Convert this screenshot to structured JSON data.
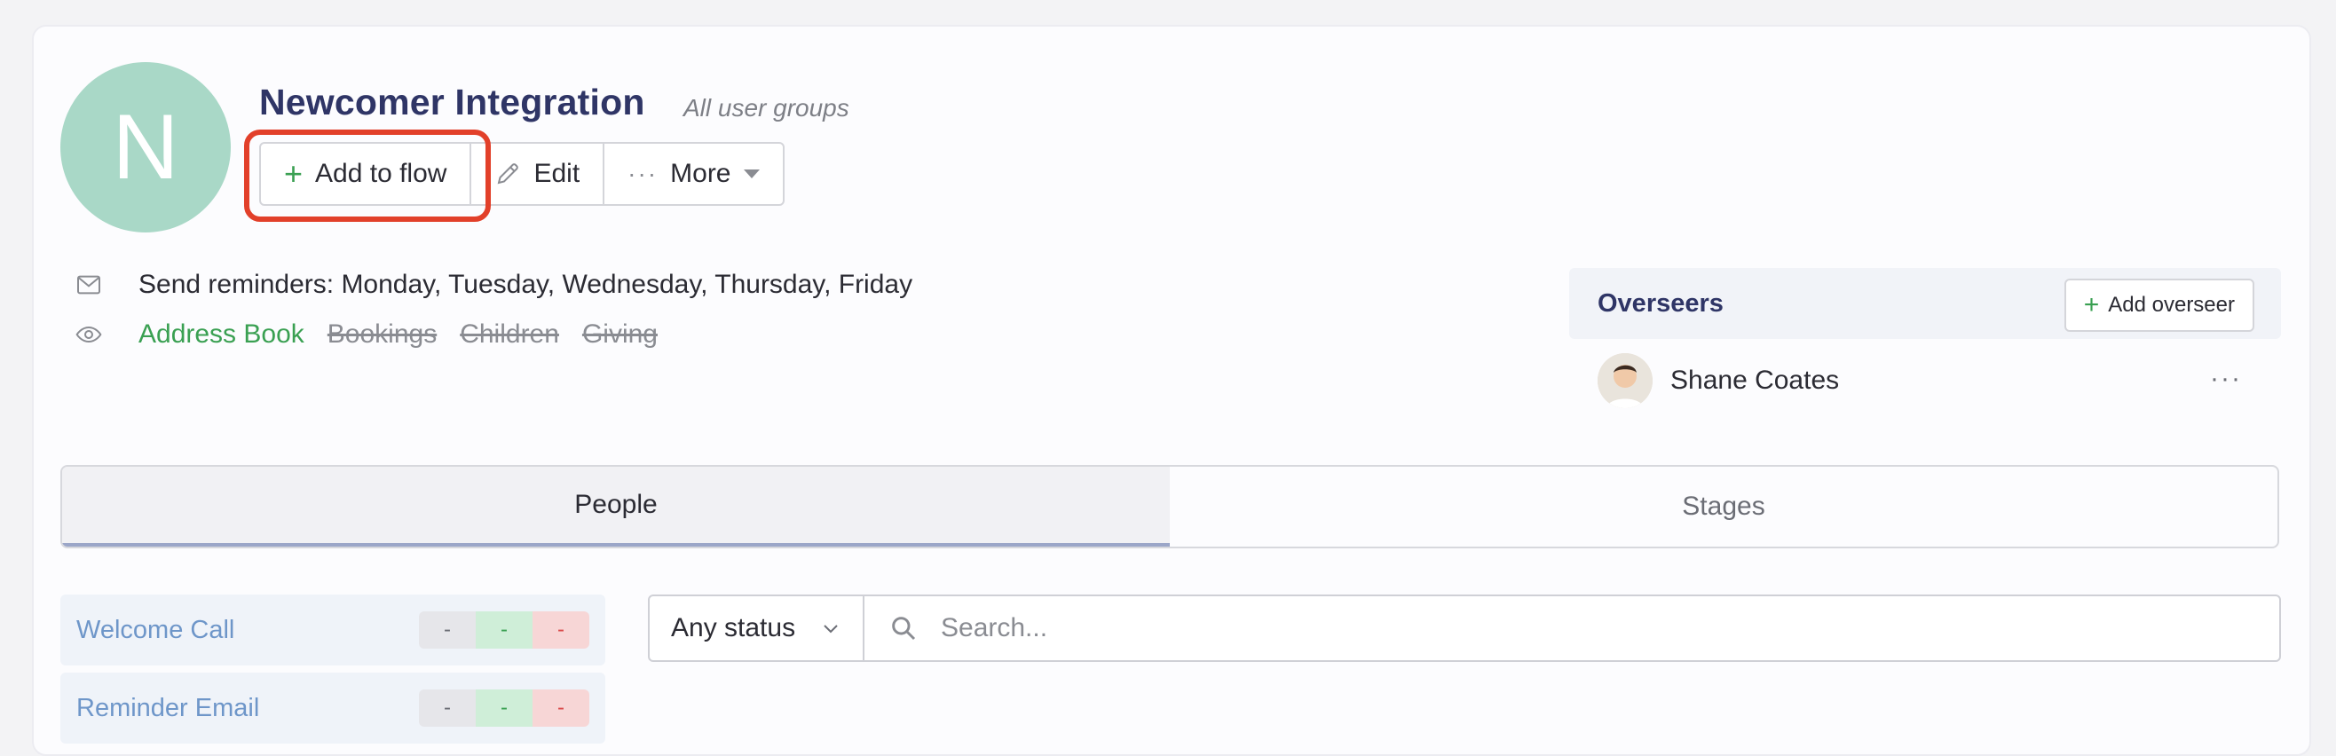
{
  "flow": {
    "avatar_letter": "N",
    "title": "Newcomer Integration",
    "scope": "All user groups"
  },
  "toolbar": {
    "add_label": "Add to flow",
    "edit_label": "Edit",
    "more_label": "More"
  },
  "reminders": {
    "text": "Send reminders: Monday, Tuesday, Wednesday, Thursday, Friday"
  },
  "apps": {
    "items": [
      "Address Book",
      "Bookings",
      "Children",
      "Giving"
    ],
    "enabled": [
      true,
      false,
      false,
      false
    ]
  },
  "overseers": {
    "heading": "Overseers",
    "add_label": "Add overseer",
    "people": [
      {
        "name": "Shane Coates"
      }
    ],
    "row_menu": "···"
  },
  "tabs": [
    {
      "label": "People",
      "active": true
    },
    {
      "label": "Stages",
      "active": false
    }
  ],
  "stages": [
    {
      "name": "Welcome Call",
      "counts": [
        "-",
        "-",
        "-"
      ]
    },
    {
      "name": "Reminder Email",
      "counts": [
        "-",
        "-",
        "-"
      ]
    }
  ],
  "filters": {
    "status_value": "Any status",
    "search_placeholder": "Search..."
  },
  "colors": {
    "accent_green": "#3aa052",
    "avatar_bg": "#a9d8c7",
    "highlight_red": "#e2402a",
    "title_navy": "#2f3566"
  }
}
